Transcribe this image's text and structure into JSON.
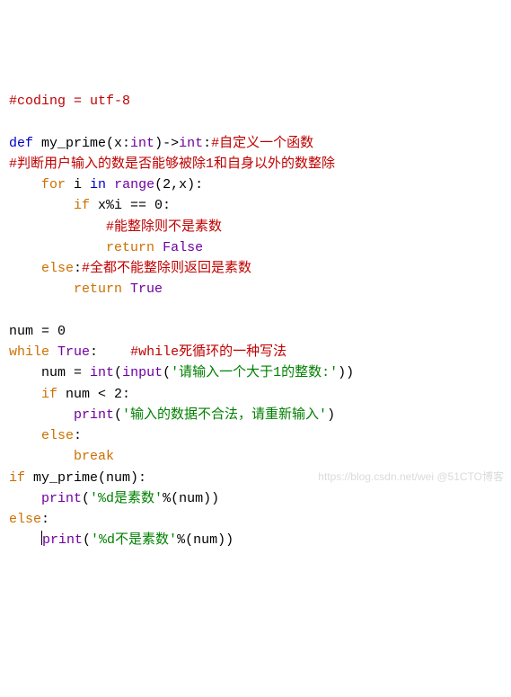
{
  "code": {
    "l1_comment": "#coding = utf-8",
    "l3_def": "def",
    "l3_name": " my_prime(x:",
    "l3_int1": "int",
    "l3_arrow": ")->",
    "l3_int2": "int",
    "l3_colon": ":",
    "l3_comment": "#自定义一个函数",
    "l4_comment": "#判断用户输入的数是否能够被除1和自身以外的数整除",
    "l5_indent": "    ",
    "l5_for": "for",
    "l5_i": " i ",
    "l5_in": "in",
    "l5_sp": " ",
    "l5_range": "range",
    "l5_args": "(2,x):",
    "l6_indent": "        ",
    "l6_if": "if",
    "l6_cond": " x%i == 0:",
    "l7_indent": "            ",
    "l7_comment": "#能整除则不是素数",
    "l8_indent": "            ",
    "l8_return": "return",
    "l8_sp": " ",
    "l8_false": "False",
    "l9_indent": "    ",
    "l9_else": "else",
    "l9_colon": ":",
    "l9_comment": "#全都不能整除则返回是素数",
    "l10_indent": "        ",
    "l10_return": "return",
    "l10_sp": " ",
    "l10_true": "True",
    "l12_num": "num = 0",
    "l13_while": "while",
    "l13_sp": " ",
    "l13_true": "True",
    "l13_colon": ":    ",
    "l13_comment": "#while死循环的一种写法",
    "l14_indent": "    ",
    "l14_num_eq": "num = ",
    "l14_int": "int",
    "l14_open": "(",
    "l14_input": "input",
    "l14_open2": "(",
    "l14_str": "'请输入一个大于1的整数:'",
    "l14_close": "))",
    "l15_indent": "    ",
    "l15_if": "if",
    "l15_cond": " num < 2:",
    "l16_indent": "        ",
    "l16_print": "print",
    "l16_open": "(",
    "l16_str": "'输入的数据不合法，请重新输入'",
    "l16_close": ")",
    "l17_indent": "    ",
    "l17_else": "else",
    "l17_colon": ":",
    "l18_indent": "        ",
    "l18_break": "break",
    "l19_if": "if",
    "l19_call": " my_prime(num):",
    "l20_indent": "    ",
    "l20_print": "print",
    "l20_open": "(",
    "l20_str": "'%d是素数'",
    "l20_rest": "%(num))",
    "l21_else": "else",
    "l21_colon": ":",
    "l22_indent": "    ",
    "l22_print": "print",
    "l22_open": "(",
    "l22_str": "'%d不是素数'",
    "l22_rest": "%(num))"
  },
  "watermark": "https://blog.csdn.net/wei  @51CTO博客"
}
